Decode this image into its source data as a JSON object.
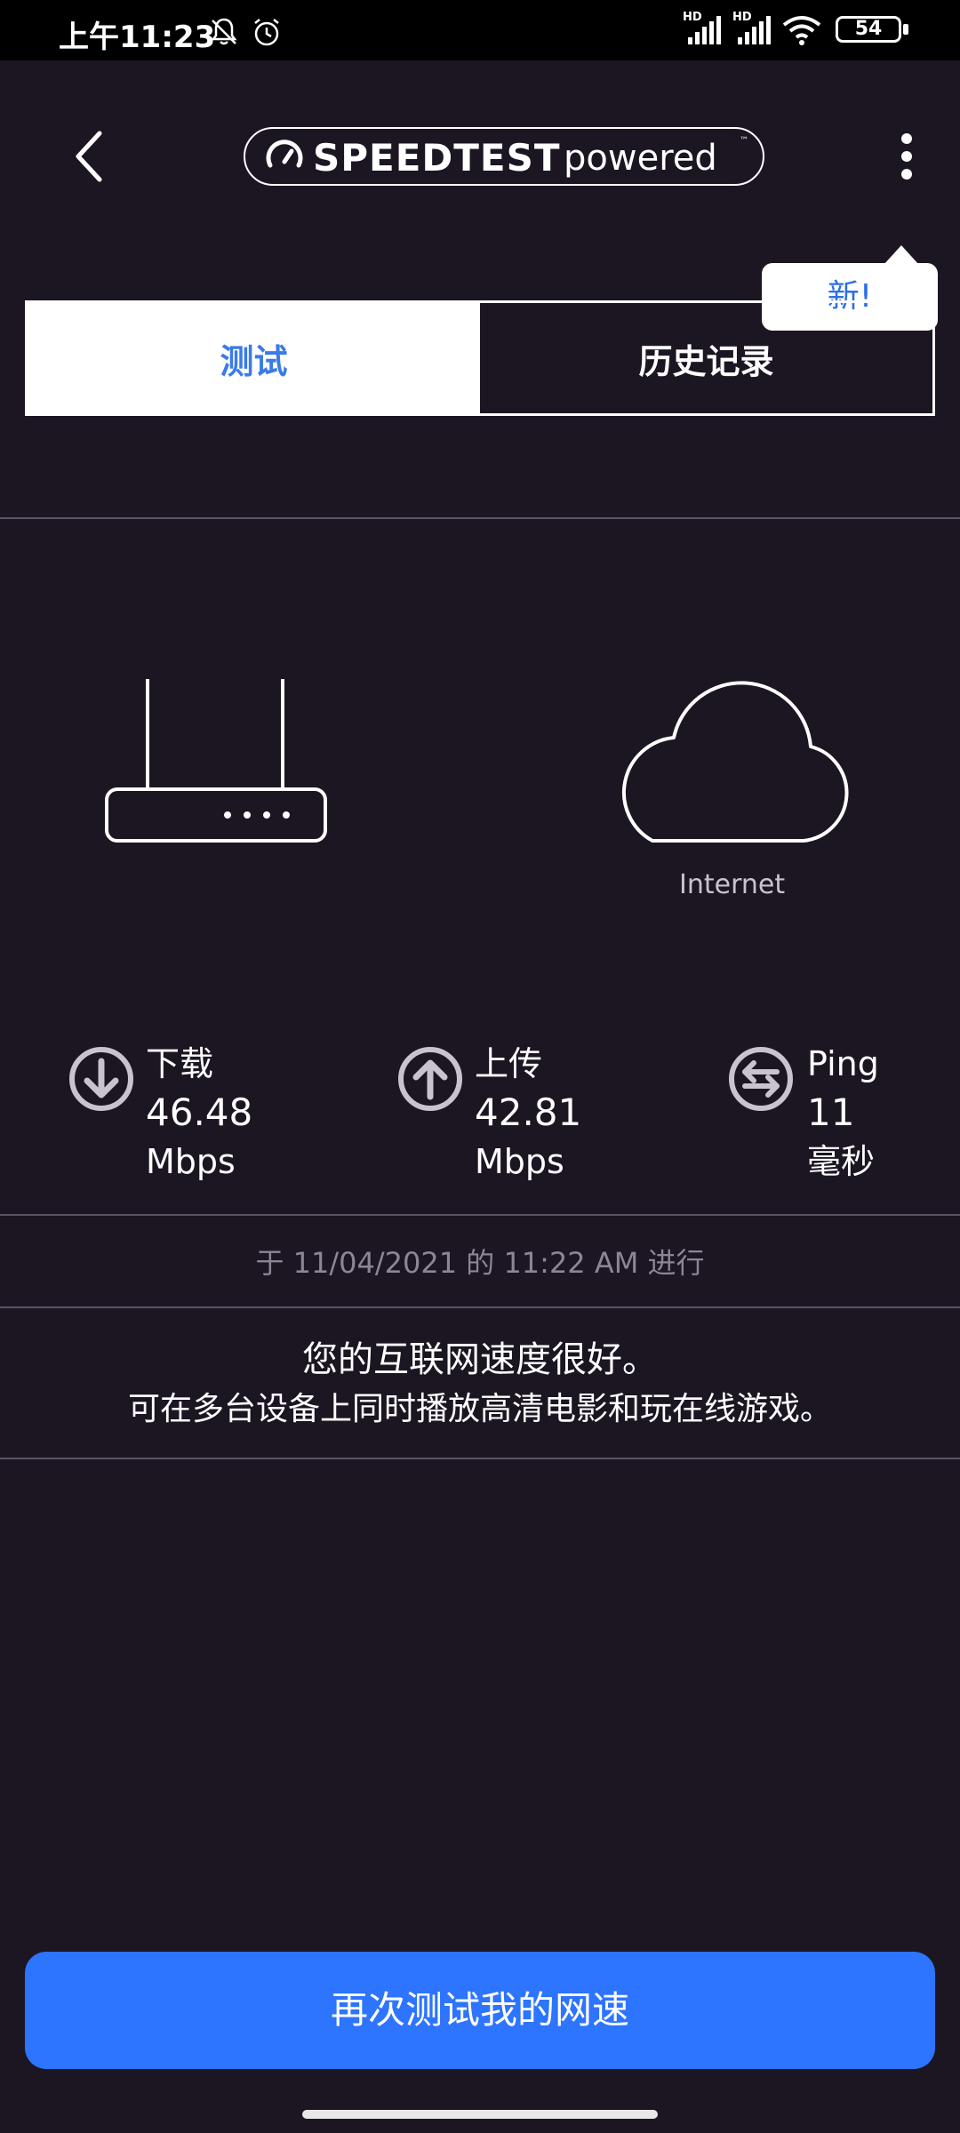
{
  "status_bar": {
    "time": "上午11:23",
    "battery": "54",
    "signal1_label": "HD",
    "signal2_label": "HD",
    "icons": [
      "bell-muted-icon",
      "alarm-icon",
      "signal-icon",
      "signal-icon",
      "wifi-icon",
      "battery-icon"
    ]
  },
  "header": {
    "logo_main": "SPEEDTEST",
    "logo_sub": "powered",
    "logo_tm": "™",
    "tooltip": "新!"
  },
  "tabs": [
    {
      "label": "测试",
      "active": true
    },
    {
      "label": "历史记录",
      "active": false
    }
  ],
  "diagram": {
    "internet_label": "Internet"
  },
  "metrics": {
    "download": {
      "label": "下载",
      "value": "46.48",
      "unit": "Mbps",
      "icon": "download-arrow-icon"
    },
    "upload": {
      "label": "上传",
      "value": "42.81",
      "unit": "Mbps",
      "icon": "upload-arrow-icon"
    },
    "ping": {
      "label": "Ping",
      "value": "11",
      "unit": "毫秒",
      "icon": "ping-arrows-icon"
    }
  },
  "timestamp": "于 11/04/2021 的 11:22 AM 进行",
  "message": {
    "title": "您的互联网速度很好。",
    "subtitle": "可在多台设备上同时播放高清电影和玩在线游戏。"
  },
  "action": {
    "retest_label": "再次测试我的网速"
  },
  "colors": {
    "background": "#1c1522",
    "accent": "#2d74ff",
    "tab_active_text": "#3a7be6"
  }
}
